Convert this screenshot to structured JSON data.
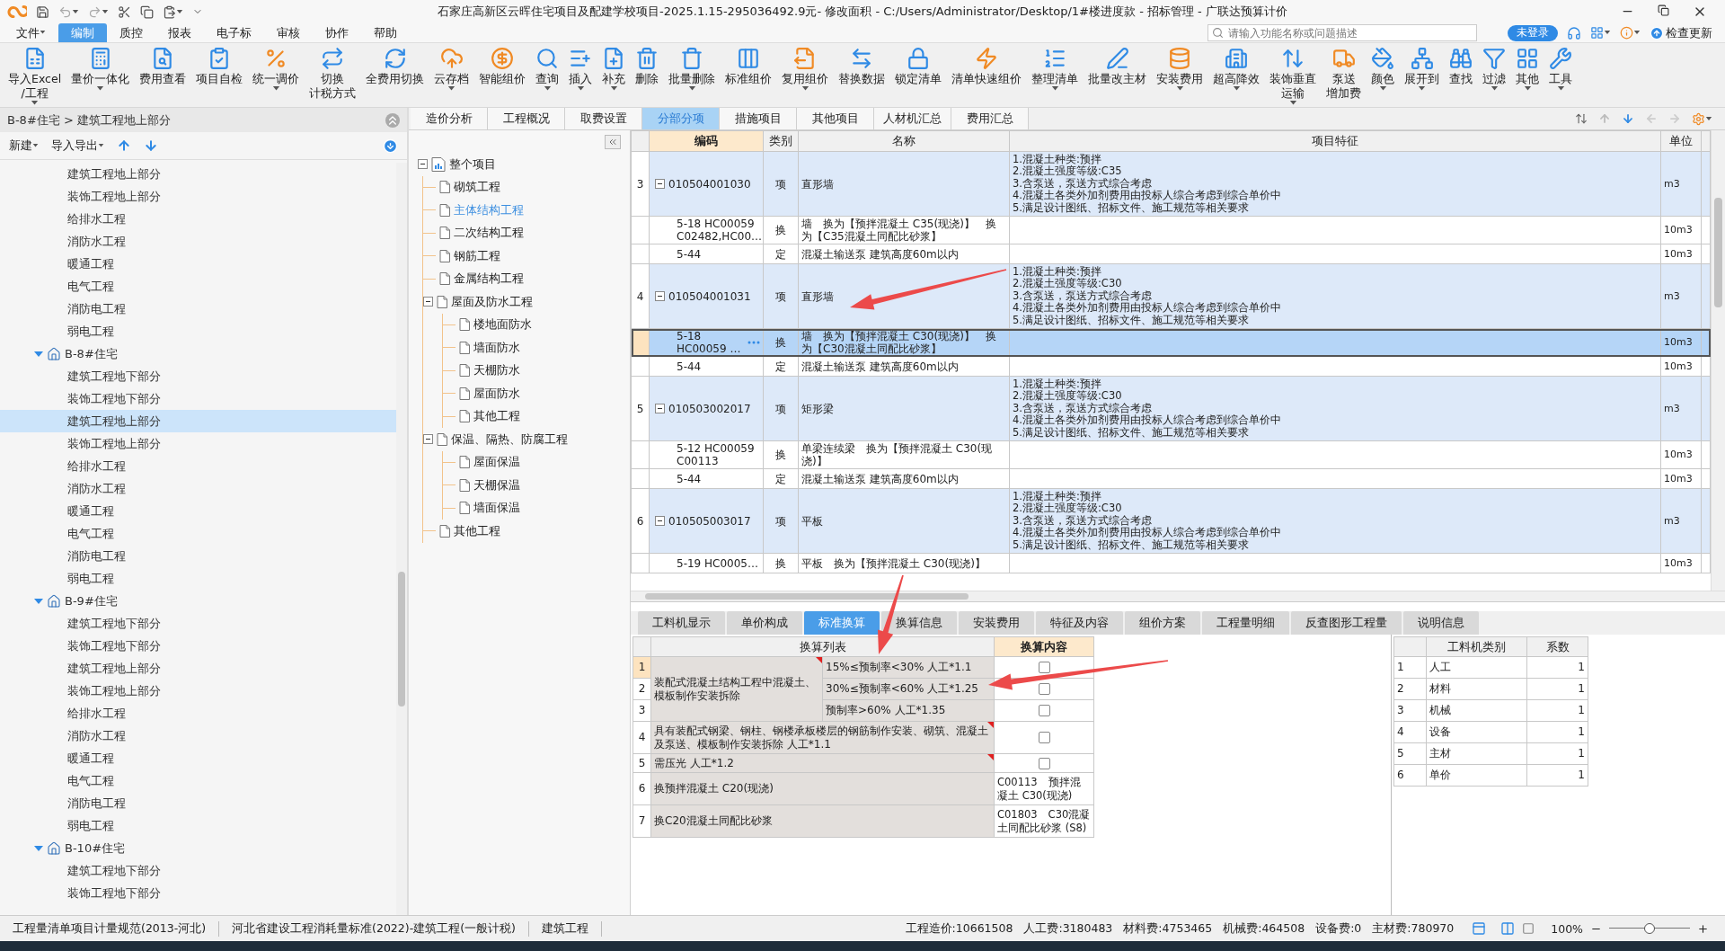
{
  "window": {
    "title": "石家庄高新区云晖住宅项目及配建学校项目-2025.1.15-295036492.9元- 修改面积 - C:/Users/Administrator/Desktop/1#楼进度款 - 招标管理 - 广联达预算计价"
  },
  "menu": [
    {
      "label": "文件",
      "dropdown": true,
      "selected": false
    },
    {
      "label": "编制",
      "dropdown": false,
      "selected": true
    },
    {
      "label": "质控",
      "dropdown": false,
      "selected": false
    },
    {
      "label": "报表",
      "dropdown": false,
      "selected": false
    },
    {
      "label": "电子标",
      "dropdown": false,
      "selected": false
    },
    {
      "label": "审核",
      "dropdown": false,
      "selected": false
    },
    {
      "label": "协作",
      "dropdown": false,
      "selected": false
    },
    {
      "label": "帮助",
      "dropdown": false,
      "selected": false
    }
  ],
  "search": {
    "placeholder": "请输入功能名称或问题描述"
  },
  "login_button": "未登录",
  "update_button": "检查更新",
  "toolbar": [
    {
      "lines": [
        "导入Excel",
        "/工程"
      ],
      "dropdown": true
    },
    {
      "lines": [
        "量价一体化"
      ],
      "dropdown": true
    },
    {
      "lines": [
        "费用查看"
      ],
      "dropdown": false
    },
    {
      "lines": [
        "项目自检"
      ],
      "dropdown": false
    },
    {
      "lines": [
        "统一调价"
      ],
      "dropdown": true
    },
    {
      "lines": [
        "切换",
        "计税方式"
      ],
      "dropdown": false
    },
    {
      "lines": [
        "全费用切换"
      ],
      "dropdown": false
    },
    {
      "lines": [
        "云存档"
      ],
      "dropdown": true
    },
    {
      "lines": [
        "智能组价"
      ],
      "dropdown": false
    },
    {
      "lines": [
        "查询"
      ],
      "dropdown": true
    },
    {
      "lines": [
        "插入"
      ],
      "dropdown": true
    },
    {
      "lines": [
        "补充"
      ],
      "dropdown": true
    },
    {
      "lines": [
        "删除"
      ],
      "dropdown": false
    },
    {
      "lines": [
        "批量删除"
      ],
      "dropdown": true
    },
    {
      "lines": [
        "标准组价"
      ],
      "dropdown": false
    },
    {
      "lines": [
        "复用组价"
      ],
      "dropdown": true
    },
    {
      "lines": [
        "替换数据"
      ],
      "dropdown": false
    },
    {
      "lines": [
        "锁定清单"
      ],
      "dropdown": false
    },
    {
      "lines": [
        "清单快速组价"
      ],
      "dropdown": false
    },
    {
      "lines": [
        "整理清单"
      ],
      "dropdown": true
    },
    {
      "lines": [
        "批量改主材"
      ],
      "dropdown": false
    },
    {
      "lines": [
        "安装费用"
      ],
      "dropdown": true
    },
    {
      "lines": [
        "超高降效"
      ],
      "dropdown": true
    },
    {
      "lines": [
        "装饰垂直",
        "运输"
      ],
      "dropdown": true
    },
    {
      "lines": [
        "泵送",
        "增加费"
      ],
      "dropdown": false
    },
    {
      "lines": [
        "颜色"
      ],
      "dropdown": true
    },
    {
      "lines": [
        "展开到"
      ],
      "dropdown": true
    },
    {
      "lines": [
        "查找"
      ],
      "dropdown": false
    },
    {
      "lines": [
        "过滤"
      ],
      "dropdown": true
    },
    {
      "lines": [
        "其他"
      ],
      "dropdown": true
    },
    {
      "lines": [
        "工具"
      ],
      "dropdown": true
    }
  ],
  "project_panel": {
    "breadcrumb": "B-8#住宅 > 建筑工程地上部分",
    "actions": [
      {
        "label": "新建",
        "dropdown": true
      },
      {
        "label": "导入导出",
        "dropdown": true
      }
    ],
    "tree": [
      {
        "children": [
          {
            "label": "建筑工程地上部分",
            "selected": false
          },
          {
            "label": "装饰工程地上部分",
            "selected": false
          },
          {
            "label": "给排水工程",
            "selected": false
          },
          {
            "label": "消防水工程",
            "selected": false
          },
          {
            "label": "暖通工程",
            "selected": false
          },
          {
            "label": "电气工程",
            "selected": false
          },
          {
            "label": "消防电工程",
            "selected": false
          },
          {
            "label": "弱电工程",
            "selected": false
          }
        ]
      },
      {
        "label": "B-8#住宅",
        "expanded": true,
        "children": [
          {
            "label": "建筑工程地下部分",
            "selected": false
          },
          {
            "label": "装饰工程地下部分",
            "selected": false
          },
          {
            "label": "建筑工程地上部分",
            "selected": true
          },
          {
            "label": "装饰工程地上部分",
            "selected": false
          },
          {
            "label": "给排水工程",
            "selected": false
          },
          {
            "label": "消防水工程",
            "selected": false
          },
          {
            "label": "暖通工程",
            "selected": false
          },
          {
            "label": "电气工程",
            "selected": false
          },
          {
            "label": "消防电工程",
            "selected": false
          },
          {
            "label": "弱电工程",
            "selected": false
          }
        ]
      },
      {
        "label": "B-9#住宅",
        "expanded": true,
        "children": [
          {
            "label": "建筑工程地下部分",
            "selected": false
          },
          {
            "label": "装饰工程地下部分",
            "selected": false
          },
          {
            "label": "建筑工程地上部分",
            "selected": false
          },
          {
            "label": "装饰工程地上部分",
            "selected": false
          },
          {
            "label": "给排水工程",
            "selected": false
          },
          {
            "label": "消防水工程",
            "selected": false
          },
          {
            "label": "暖通工程",
            "selected": false
          },
          {
            "label": "电气工程",
            "selected": false
          },
          {
            "label": "消防电工程",
            "selected": false
          },
          {
            "label": "弱电工程",
            "selected": false
          }
        ]
      },
      {
        "label": "B-10#住宅",
        "expanded": true,
        "children": [
          {
            "label": "建筑工程地下部分",
            "selected": false
          },
          {
            "label": "装饰工程地下部分",
            "selected": false
          }
        ]
      }
    ]
  },
  "main_tabs": [
    {
      "label": "造价分析",
      "selected": false
    },
    {
      "label": "工程概况",
      "selected": false
    },
    {
      "label": "取费设置",
      "selected": false
    },
    {
      "label": "分部分项",
      "selected": true
    },
    {
      "label": "措施项目",
      "selected": false
    },
    {
      "label": "其他项目",
      "selected": false
    },
    {
      "label": "人材机汇总",
      "selected": false
    },
    {
      "label": "费用汇总",
      "selected": false
    }
  ],
  "structure_tree": {
    "label": "整个项目",
    "expanded": true,
    "selected": false,
    "children": [
      {
        "label": "砌筑工程",
        "selected": false
      },
      {
        "label": "主体结构工程",
        "selected": true
      },
      {
        "label": "二次结构工程",
        "selected": false
      },
      {
        "label": "钢筋工程",
        "selected": false
      },
      {
        "label": "金属结构工程",
        "selected": false
      },
      {
        "label": "屋面及防水工程",
        "selected": false,
        "expanded": true,
        "children": [
          {
            "label": "楼地面防水",
            "selected": false
          },
          {
            "label": "墙面防水",
            "selected": false
          },
          {
            "label": "天棚防水",
            "selected": false
          },
          {
            "label": "屋面防水",
            "selected": false
          },
          {
            "label": "其他工程",
            "selected": false
          }
        ]
      },
      {
        "label": "保温、隔热、防腐工程",
        "selected": false,
        "expanded": true,
        "children": [
          {
            "label": "屋面保温",
            "selected": false
          },
          {
            "label": "天棚保温",
            "selected": false
          },
          {
            "label": "墙面保温",
            "selected": false
          }
        ]
      },
      {
        "label": "其他工程",
        "selected": false
      }
    ]
  },
  "bill_table": {
    "columns": [
      {
        "label": "编码",
        "active": true
      },
      {
        "label": "类别",
        "active": false
      },
      {
        "label": "名称",
        "active": false
      },
      {
        "label": "项目特征",
        "active": false
      },
      {
        "label": "单位",
        "active": false
      }
    ],
    "rows": [
      {
        "kind": "item",
        "number": "3",
        "code": "010504001030",
        "type": "项",
        "name": "直形墙",
        "features": "1.混凝土种类:预拌\n2.混凝土强度等级:C35\n3.含泵送，泵送方式综合考虑\n4.混凝土各类外加剂费用由投标人综合考虑到综合单价中\n5.满足设计图纸、招标文件、施工规范等相关要求",
        "unit": "m3",
        "expanded": true,
        "selected": false
      },
      {
        "kind": "sub",
        "code": "5-18 HC00059\nC02482,HC00…",
        "type": "换",
        "name": "墙　换为【预拌混凝土 C35(现浇)】　换为【C35混凝土同配比砂浆】",
        "unit": "10m3",
        "selected": false
      },
      {
        "kind": "sub",
        "code": "5-44",
        "type": "定",
        "name": "混凝土输送泵 建筑高度60m以内",
        "unit": "10m3",
        "selected": false
      },
      {
        "kind": "item",
        "number": "4",
        "code": "010504001031",
        "type": "项",
        "name": "直形墙",
        "features": "1.混凝土种类:预拌\n2.混凝土强度等级:C30\n3.含泵送，泵送方式综合考虑\n4.混凝土各类外加剂费用由投标人综合考虑到综合单价中\n5.满足设计图纸、招标文件、施工规范等相关要求",
        "unit": "m3",
        "expanded": true,
        "selected": false
      },
      {
        "kind": "sub",
        "code": "5-18\nHC00059 …",
        "type": "换",
        "name": "墙　换为【预拌混凝土 C30(现浇)】　换为【C30混凝土同配比砂浆】",
        "unit": "10m3",
        "selected": true
      },
      {
        "kind": "sub",
        "code": "5-44",
        "type": "定",
        "name": "混凝土输送泵 建筑高度60m以内",
        "unit": "10m3",
        "selected": false
      },
      {
        "kind": "item",
        "number": "5",
        "code": "010503002017",
        "type": "项",
        "name": "矩形梁",
        "features": "1.混凝土种类:预拌\n2.混凝土强度等级:C30\n3.含泵送，泵送方式综合考虑\n4.混凝土各类外加剂费用由投标人综合考虑到综合单价中\n5.满足设计图纸、招标文件、施工规范等相关要求",
        "unit": "m3",
        "expanded": true,
        "selected": false
      },
      {
        "kind": "sub",
        "code": "5-12 HC00059\nC00113",
        "type": "换",
        "name": "单梁连续梁　换为【预拌混凝土 C30(现浇)】",
        "unit": "10m3",
        "selected": false
      },
      {
        "kind": "sub",
        "code": "5-44",
        "type": "定",
        "name": "混凝土输送泵 建筑高度60m以内",
        "unit": "10m3",
        "selected": false
      },
      {
        "kind": "item",
        "number": "6",
        "code": "010505003017",
        "type": "项",
        "name": "平板",
        "features": "1.混凝土种类:预拌\n2.混凝土强度等级:C30\n3.含泵送，泵送方式综合考虑\n4.混凝土各类外加剂费用由投标人综合考虑到综合单价中\n5.满足设计图纸、招标文件、施工规范等相关要求",
        "unit": "m3",
        "expanded": true,
        "selected": false
      },
      {
        "kind": "sub",
        "code": "5-19 HC0005…",
        "type": "换",
        "name": "平板　换为【预拌混凝土 C30(现浇)】",
        "unit": "10m3",
        "selected": false
      }
    ]
  },
  "bottom_tabs": [
    {
      "label": "工料机显示",
      "selected": false
    },
    {
      "label": "单价构成",
      "selected": false
    },
    {
      "label": "标准换算",
      "selected": true
    },
    {
      "label": "换算信息",
      "selected": false
    },
    {
      "label": "安装费用",
      "selected": false
    },
    {
      "label": "特征及内容",
      "selected": false
    },
    {
      "label": "组价方案",
      "selected": false
    },
    {
      "label": "工程量明细",
      "selected": false
    },
    {
      "label": "反查图形工程量",
      "selected": false
    },
    {
      "label": "说明信息",
      "selected": false
    }
  ],
  "conversion_table": {
    "columns": [
      "换算列表",
      "换算内容"
    ],
    "rows": [
      {
        "kind": "group",
        "text": "装配式混凝土结构工程中混凝土、模板制作安装拆除",
        "marked": true,
        "options": [
          {
            "number": "1",
            "text": "15%≤预制率<30% 人工*1.1",
            "checked": false,
            "selected": true
          },
          {
            "number": "2",
            "text": "30%≤预制率<60% 人工*1.25",
            "checked": false,
            "selected": false
          },
          {
            "number": "3",
            "text": "预制率>60% 人工*1.35",
            "checked": false,
            "selected": false
          }
        ]
      },
      {
        "kind": "check",
        "number": "4",
        "text": "具有装配式钢梁、钢柱、钢楼承板楼层的钢筋制作安装、砌筑、混凝土及泵送、模板制作安装拆除 人工*1.1",
        "checked": false,
        "marked": true
      },
      {
        "kind": "check",
        "number": "5",
        "text": "需压光 人工*1.2",
        "checked": false,
        "marked": true
      },
      {
        "kind": "replace",
        "number": "6",
        "text": "换预拌混凝土 C20(现浇)",
        "content": "C00113　预拌混凝土 C30(现浇)"
      },
      {
        "kind": "replace",
        "number": "7",
        "text": "换C20混凝土同配比砂浆",
        "content": "C01803　C30混凝土同配比砂浆 (S8)"
      }
    ]
  },
  "coefficient_table": {
    "columns": [
      "工料机类别",
      "系数"
    ],
    "rows": [
      {
        "number": "1",
        "category": "人工",
        "value": "1"
      },
      {
        "number": "2",
        "category": "材料",
        "value": "1"
      },
      {
        "number": "3",
        "category": "机械",
        "value": "1"
      },
      {
        "number": "4",
        "category": "设备",
        "value": "1"
      },
      {
        "number": "5",
        "category": "主材",
        "value": "1"
      },
      {
        "number": "6",
        "category": "单价",
        "value": "1"
      }
    ]
  },
  "status_bar": {
    "standards": [
      "工程量清单项目计量规范(2013-河北)",
      "河北省建设工程消耗量标准(2022)-建筑工程(一般计税)",
      "建筑工程"
    ],
    "totals": [
      "工程造价:10661508",
      "人工费:3180483",
      "材料费:4753465",
      "机械费:464508",
      "设备费:0",
      "主材费:780970"
    ],
    "zoom": "100%",
    "zoom_slider": {
      "level": 0.5
    }
  }
}
